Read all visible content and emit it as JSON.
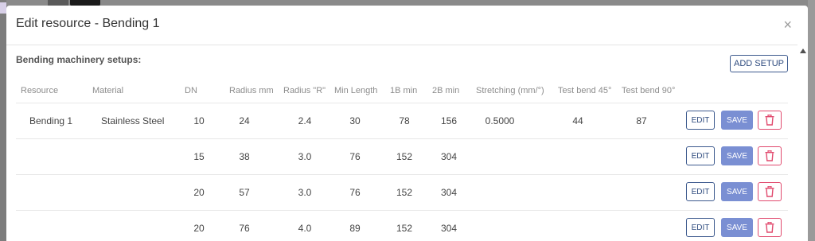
{
  "modal": {
    "title": "Edit resource - Bending 1",
    "close_symbol": "×",
    "section_label": "Bending machinery setups:",
    "add_setup_label": "ADD SETUP"
  },
  "table": {
    "headers": [
      "Resource",
      "Material",
      "DN",
      "Radius mm",
      "Radius \"R\"",
      "Min Length",
      "1B min",
      "2B min",
      "Stretching (mm/°)",
      "Test bend 45°",
      "Test bend 90°"
    ],
    "rows": [
      {
        "resource": "Bending 1",
        "material": "Stainless Steel",
        "dn": "10",
        "radius_mm": "24",
        "radius_r": "2.4",
        "min_length": "30",
        "b1_min": "78",
        "b2_min": "156",
        "stretching": "0.5000",
        "test45": "44",
        "test90": "87"
      },
      {
        "resource": "",
        "material": "",
        "dn": "15",
        "radius_mm": "38",
        "radius_r": "3.0",
        "min_length": "76",
        "b1_min": "152",
        "b2_min": "304",
        "stretching": "",
        "test45": "",
        "test90": ""
      },
      {
        "resource": "",
        "material": "",
        "dn": "20",
        "radius_mm": "57",
        "radius_r": "3.0",
        "min_length": "76",
        "b1_min": "152",
        "b2_min": "304",
        "stretching": "",
        "test45": "",
        "test90": ""
      },
      {
        "resource": "",
        "material": "",
        "dn": "20",
        "radius_mm": "76",
        "radius_r": "4.0",
        "min_length": "89",
        "b1_min": "152",
        "b2_min": "304",
        "stretching": "",
        "test45": "",
        "test90": ""
      }
    ],
    "row_actions": {
      "edit_label": "EDIT",
      "save_label": "SAVE",
      "delete_icon": "trash-icon"
    }
  },
  "colors": {
    "primary_outline": "#3d5a8e",
    "save_fill": "#7a8fd3",
    "delete_accent": "#e14a6e",
    "overlay": "#8a8a8a"
  }
}
